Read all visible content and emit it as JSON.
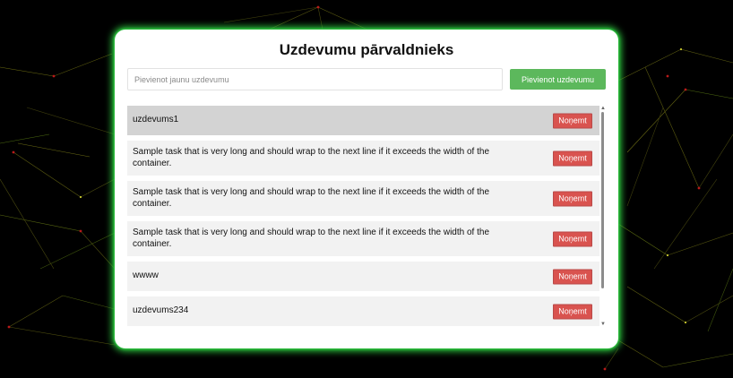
{
  "app": {
    "title": "Uzdevumu pārvaldnieks"
  },
  "input": {
    "placeholder": "Pievienot jaunu uzdevumu",
    "value": ""
  },
  "add_button": {
    "label": "Pievienot uzdevumu"
  },
  "tasks": [
    {
      "text": "uzdevums1",
      "remove_label": "Noņemt",
      "selected": true
    },
    {
      "text": "Sample task that is very long and should wrap to the next line if it exceeds the width of the container.",
      "remove_label": "Noņemt",
      "selected": false
    },
    {
      "text": "Sample task that is very long and should wrap to the next line if it exceeds the width of the container.",
      "remove_label": "Noņemt",
      "selected": false
    },
    {
      "text": "Sample task that is very long and should wrap to the next line if it exceeds the width of the container.",
      "remove_label": "Noņemt",
      "selected": false
    },
    {
      "text": "wwww",
      "remove_label": "Noņemt",
      "selected": false
    },
    {
      "text": "uzdevums234",
      "remove_label": "Noņemt",
      "selected": false
    }
  ],
  "colors": {
    "accent_green": "#5cb85c",
    "remove_red": "#d9534f",
    "glow": "#2ecc40",
    "selected_row": "#d3d3d3",
    "row": "#f2f2f2",
    "background": "#000000"
  },
  "icons": {
    "scroll_up": "scroll-up-arrow-icon",
    "scroll_down": "scroll-down-arrow-icon"
  }
}
